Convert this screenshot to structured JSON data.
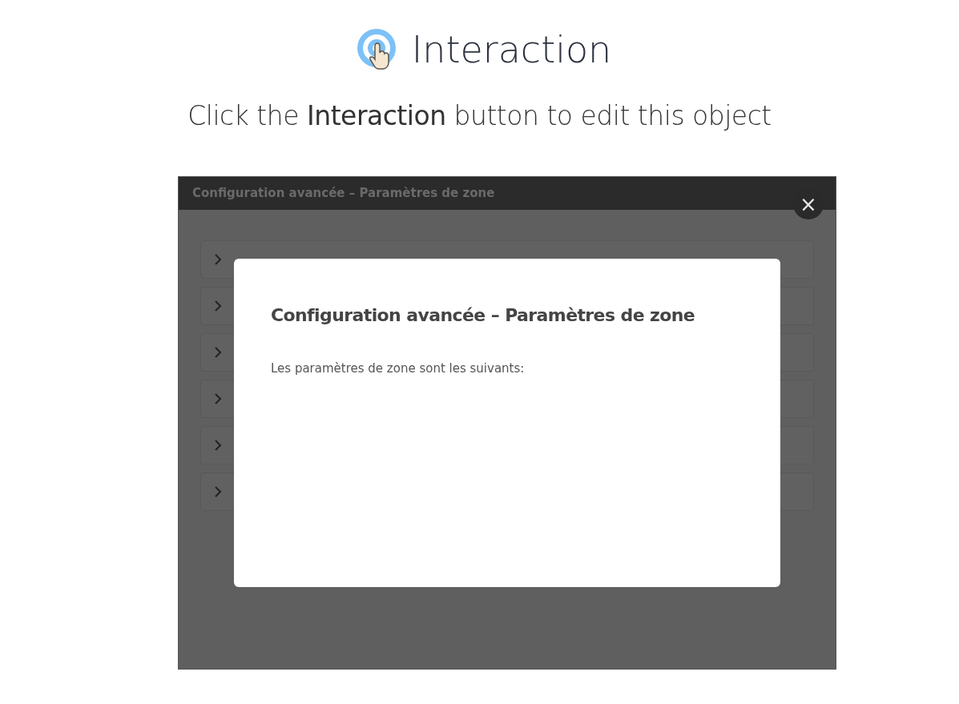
{
  "header": {
    "title": "Interaction",
    "instruction": "Click the **Interaction** button to edit this object"
  },
  "frame": {
    "title": "Configuration avancée – Paramètres de zone",
    "close_label": "×",
    "sections": [
      {
        "expanded": false
      },
      {
        "expanded": false
      },
      {
        "expanded": false
      },
      {
        "expanded": false
      },
      {
        "expanded": false
      },
      {
        "expanded": false
      }
    ]
  },
  "modal": {
    "title": "Configuration avancée – Paramètres de zone",
    "body": "Les paramètres de zone sont les suivants:"
  }
}
